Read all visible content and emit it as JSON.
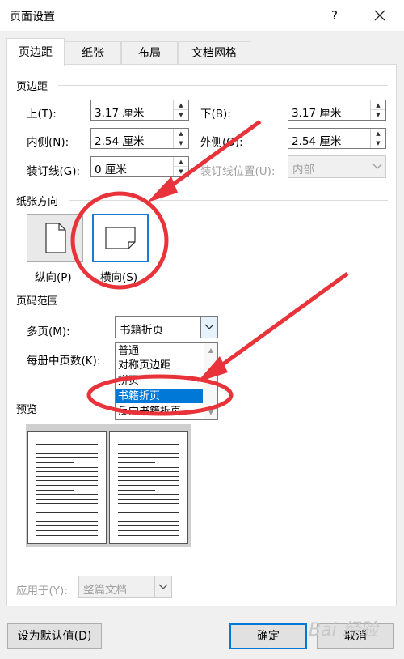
{
  "window": {
    "title": "页面设置",
    "help_glyph": "?"
  },
  "tabs": [
    {
      "label": "页边距"
    },
    {
      "label": "纸张"
    },
    {
      "label": "布局"
    },
    {
      "label": "文档网格"
    }
  ],
  "margins": {
    "section_label": "页边距",
    "top": {
      "label": "上(T):",
      "value": "3.17 厘米"
    },
    "bottom": {
      "label": "下(B):",
      "value": "3.17 厘米"
    },
    "inside": {
      "label": "内侧(N):",
      "value": "2.54 厘米"
    },
    "outside": {
      "label": "外侧(O):",
      "value": "2.54 厘米"
    },
    "gutter": {
      "label": "装订线(G):",
      "value": "0 厘米"
    },
    "gutter_position": {
      "label": "装订线位置(U):",
      "value": "内部"
    }
  },
  "orientation": {
    "section_label": "纸张方向",
    "portrait_label": "纵向(P)",
    "landscape_label": "横向(S)",
    "selected": "landscape"
  },
  "pages": {
    "section_label": "页码范围",
    "multiple_label": "多页(M):",
    "multiple_value": "书籍折页",
    "sheets_label": "每册中页数(K):",
    "options": [
      "普通",
      "对称页边距",
      "拼页",
      "书籍折页",
      "反向书籍折页"
    ],
    "selected_index": 3
  },
  "preview": {
    "section_label": "预览"
  },
  "apply": {
    "label": "应用于(Y):",
    "value": "整篇文档"
  },
  "buttons": {
    "set_default": "设为默认值(D)",
    "ok": "确定",
    "cancel": "取消"
  },
  "annotation_color": "#e8333a",
  "watermark": "Bai 经验"
}
